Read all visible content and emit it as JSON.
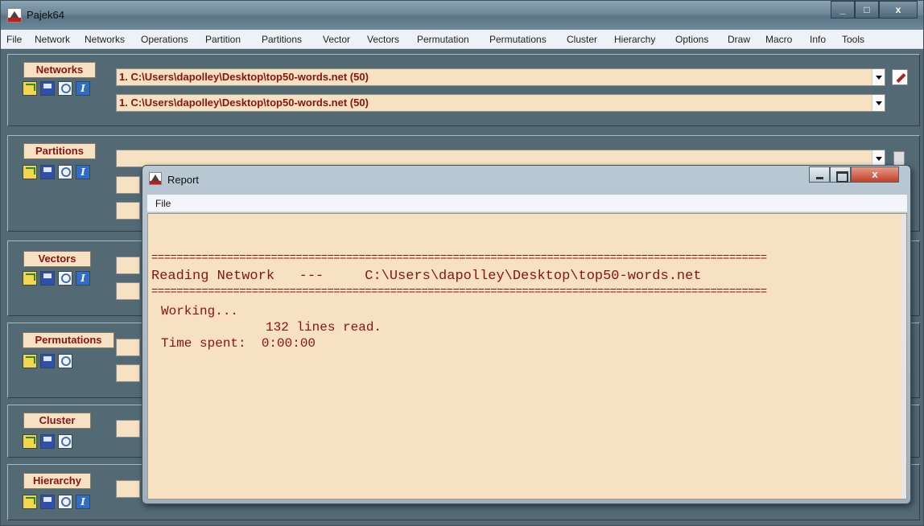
{
  "main_window": {
    "title": "Pajek64",
    "controls": {
      "minimize": "_",
      "maximize": "□",
      "close": "x"
    }
  },
  "menubar": {
    "items": [
      "File",
      "Network",
      "Networks",
      "Operations",
      "Partition",
      "Partitions",
      "Vector",
      "Vectors",
      "Permutation",
      "Permutations",
      "Cluster",
      "Hierarchy",
      "Options",
      "Draw",
      "Macro",
      "Info",
      "Tools"
    ]
  },
  "panels": {
    "networks": {
      "label": "Networks",
      "dropdown1": "1. C:\\Users\\dapolley\\Desktop\\top50-words.net (50)",
      "dropdown2": "1. C:\\Users\\dapolley\\Desktop\\top50-words.net (50)"
    },
    "partitions": {
      "label": "Partitions"
    },
    "vectors": {
      "label": "Vectors"
    },
    "permutations": {
      "label": "Permutations"
    },
    "cluster": {
      "label": "Cluster"
    },
    "hierarchy": {
      "label": "Hierarchy"
    }
  },
  "report": {
    "title": "Report",
    "close_label": "x",
    "menu_file": "File",
    "separator": "==================================================================================================",
    "reading_line": "Reading Network   ---     C:\\Users\\dapolley\\Desktop\\top50-words.net",
    "working": "Working...",
    "lines_read": "132 lines read.",
    "time_spent": "Time spent:  0:00:00"
  },
  "colors": {
    "panel_bg": "#536a75",
    "field_bg": "#f6e2c2",
    "text_red": "#8b1212"
  },
  "icons": [
    "open-file-icon",
    "save-icon",
    "view-icon",
    "info-icon",
    "edit-pencil-icon",
    "pajek-app-icon"
  ]
}
